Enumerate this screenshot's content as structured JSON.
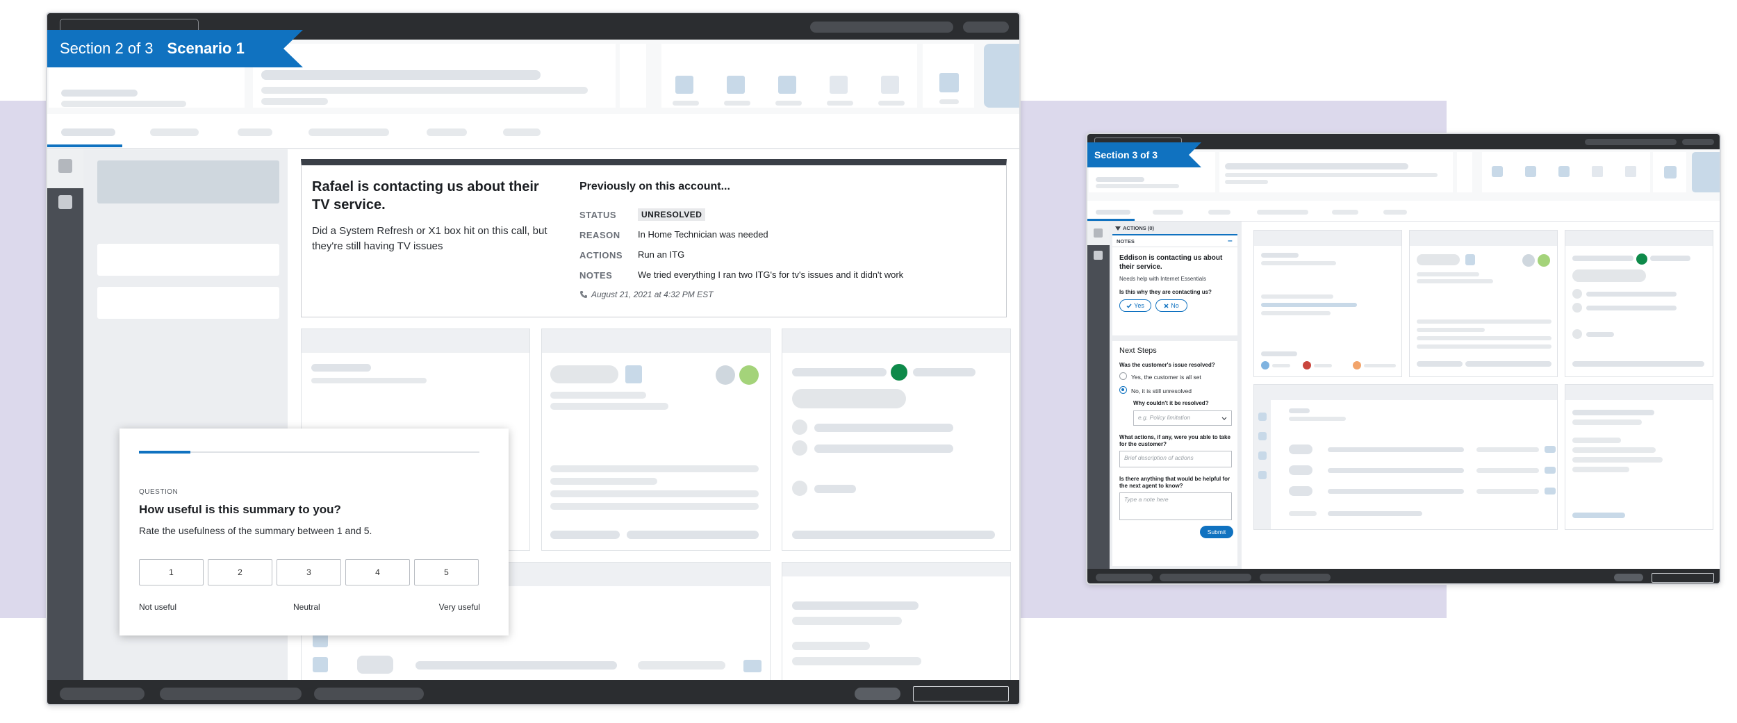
{
  "scenario1": {
    "section_label": "Section 2 of 3",
    "scenario_label": "Scenario 1",
    "summary": {
      "headline": "Rafael is contacting us about their TV service.",
      "detail": "Did a System Refresh or X1 box hit on this call, but they're still having TV issues",
      "history_title": "Previously on this account...",
      "rows": [
        {
          "key": "STATUS",
          "value": "UNRESOLVED"
        },
        {
          "key": "REASON",
          "value": "In Home Technician was needed"
        },
        {
          "key": "ACTIONS",
          "value": "Run an ITG"
        },
        {
          "key": "NOTES",
          "value": "We tried everything I ran two ITG's for tv's issues and it didn't work"
        }
      ],
      "timestamp": "August 21, 2021 at 4:32 PM EST"
    },
    "survey": {
      "eyebrow": "QUESTION",
      "question": "How useful is this summary to you?",
      "instruction": "Rate the usefulness of the summary between 1 and 5.",
      "options": [
        "1",
        "2",
        "3",
        "4",
        "5"
      ],
      "scale_low": "Not useful",
      "scale_mid": "Neutral",
      "scale_high": "Very useful",
      "progress_fraction": 0.15
    }
  },
  "scenario3": {
    "section_label": "Section 3 of 3",
    "actions_header": "ACTIONS (0)",
    "notes_header": "NOTES",
    "collapse_symbol": "–",
    "headline": "Eddison is contacting us about their service.",
    "subtext": "Needs help with Internet Essentials",
    "confirm_question": "Is this why they are contacting us?",
    "yes_label": "Yes",
    "no_label": "No",
    "next_steps_title": "Next Steps",
    "resolved_question": "Was the customer's issue resolved?",
    "option_resolved": "Yes, the customer is all set",
    "option_unresolved": "No, it is still unresolved",
    "why_question": "Why couldn't it be resolved?",
    "why_placeholder": "e.g. Policy limitation",
    "actions_question": "What actions, if any, were you able to take for the customer?",
    "actions_placeholder": "Brief description of actions",
    "helpful_question": "Is there anything that would be helpful for the next agent to know?",
    "note_placeholder": "Type a note here",
    "submit_label": "Submit"
  },
  "colors": {
    "brand_blue": "#1072c0",
    "dark_chrome": "#2b2d30",
    "backdrop_lavender": "#dcd9ec",
    "status_green": "#0e8a4a",
    "status_light_green": "#a4d37a",
    "status_red": "#c9463d",
    "status_orange": "#f2a46b"
  },
  "icons": [
    "phone-icon",
    "check-icon",
    "x-icon",
    "chevron-down-icon",
    "triangle-down-icon"
  ]
}
